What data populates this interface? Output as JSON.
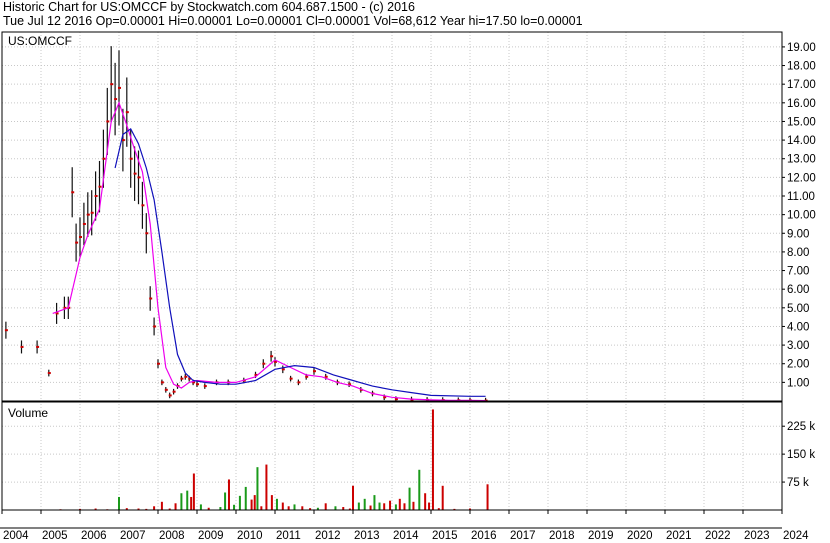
{
  "header": {
    "line1": "Historic Chart for US:OMCCF by Stockwatch.com 604.687.1500 - (c) 2016",
    "line2": "Tue Jul 12 2016   Op=0.00001   Hi=0.00001   Lo=0.00001   Cl=0.00001   Vol=68,612   Year hi=17.50   lo=0.00001"
  },
  "chart_data": {
    "type": "line",
    "price_panel": {
      "label": "US:OMCCF",
      "ylim": [
        0,
        19.8
      ],
      "yticks": [
        "1.00",
        "2.00",
        "3.00",
        "4.00",
        "5.00",
        "6.00",
        "7.00",
        "8.00",
        "9.00",
        "10.00",
        "11.00",
        "12.00",
        "13.00",
        "14.00",
        "15.00",
        "16.00",
        "17.00",
        "18.00",
        "19.00"
      ],
      "grid": true,
      "series": [
        {
          "role": "price",
          "color": "#cc0000",
          "x": [
            2004.1,
            2004.5,
            2004.9,
            2005.2,
            2005.4,
            2005.6,
            2005.7,
            2005.8,
            2005.9,
            2006.0,
            2006.1,
            2006.2,
            2006.3,
            2006.4,
            2006.5,
            2006.6,
            2006.7,
            2006.8,
            2006.9,
            2007.0,
            2007.1,
            2007.2,
            2007.3,
            2007.4,
            2007.5,
            2007.6,
            2007.7,
            2007.8,
            2007.9,
            2008.0,
            2008.1,
            2008.2,
            2008.3,
            2008.4,
            2008.5,
            2008.6,
            2008.7,
            2008.8,
            2008.9,
            2009.0,
            2009.2,
            2009.5,
            2009.8,
            2010.2,
            2010.5,
            2010.7,
            2010.9,
            2011.0,
            2011.2,
            2011.4,
            2011.6,
            2011.8,
            2012.0,
            2012.3,
            2012.6,
            2012.9,
            2013.2,
            2013.5,
            2013.8,
            2014.1,
            2014.5,
            2014.9,
            2015.3,
            2015.7,
            2016.0,
            2016.4
          ],
          "y": [
            3.8,
            2.9,
            2.9,
            1.5,
            4.7,
            5.0,
            5.0,
            11.2,
            8.5,
            8.8,
            9.5,
            10.0,
            10.1,
            11.0,
            11.5,
            13.0,
            15.0,
            17.0,
            16.2,
            16.8,
            14.0,
            15.5,
            13.0,
            12.2,
            12.0,
            10.5,
            9.0,
            5.5,
            4.0,
            2.0,
            1.0,
            0.6,
            0.3,
            0.5,
            0.8,
            1.2,
            1.3,
            1.2,
            1.0,
            0.9,
            0.8,
            1.0,
            1.0,
            1.1,
            1.4,
            2.0,
            2.4,
            2.1,
            1.7,
            1.2,
            1.0,
            1.3,
            1.6,
            1.3,
            1.0,
            0.9,
            0.6,
            0.4,
            0.2,
            0.1,
            0.08,
            0.06,
            0.05,
            0.04,
            0.03,
            0.02
          ]
        },
        {
          "role": "short_ma",
          "color": "#ee00ee",
          "x": [
            2005.3,
            2005.7,
            2006.0,
            2006.2,
            2006.5,
            2006.8,
            2007.0,
            2007.2,
            2007.4,
            2007.6,
            2007.8,
            2008.0,
            2008.2,
            2008.4,
            2008.6,
            2008.8,
            2009.0,
            2009.5,
            2010.0,
            2010.5,
            2011.0,
            2011.4,
            2011.8,
            2012.2,
            2012.6,
            2013.0,
            2013.5,
            2014.0,
            2014.5,
            2015.0,
            2015.5,
            2016.0,
            2016.4
          ],
          "y": [
            4.7,
            5.0,
            7.7,
            8.9,
            10.3,
            15.0,
            16.0,
            14.8,
            13.5,
            12.3,
            9.5,
            5.0,
            1.8,
            0.9,
            0.7,
            1.0,
            1.1,
            1.0,
            1.0,
            1.3,
            2.2,
            1.8,
            1.4,
            1.3,
            1.0,
            0.8,
            0.4,
            0.2,
            0.1,
            0.06,
            0.04,
            0.03,
            0.02
          ]
        },
        {
          "role": "long_ma",
          "color": "#1010bb",
          "x": [
            2006.9,
            2007.1,
            2007.3,
            2007.5,
            2007.7,
            2007.9,
            2008.1,
            2008.3,
            2008.5,
            2008.7,
            2008.9,
            2009.2,
            2009.6,
            2010.0,
            2010.5,
            2011.0,
            2011.5,
            2012.0,
            2012.5,
            2013.0,
            2013.5,
            2014.0,
            2014.5,
            2015.0,
            2016.0,
            2016.4
          ],
          "y": [
            12.5,
            14.3,
            14.6,
            13.8,
            12.5,
            10.8,
            8.0,
            5.0,
            2.5,
            1.5,
            1.1,
            1.0,
            0.9,
            0.9,
            1.1,
            1.7,
            1.9,
            1.8,
            1.4,
            1.1,
            0.8,
            0.6,
            0.45,
            0.3,
            0.25,
            0.25
          ]
        }
      ]
    },
    "volume_panel": {
      "label": "Volume",
      "ylim": [
        0,
        290000
      ],
      "yticks": [
        "75 k",
        "150 k",
        "225 k"
      ],
      "bars": [
        {
          "x": 2005.5,
          "y": 2000,
          "c": "#cc0000"
        },
        {
          "x": 2006.0,
          "y": 3000,
          "c": "#cc0000"
        },
        {
          "x": 2006.4,
          "y": 4000,
          "c": "#cc0000"
        },
        {
          "x": 2006.7,
          "y": 2000,
          "c": "#cc0000"
        },
        {
          "x": 2007.0,
          "y": 35000,
          "c": "#1a9a1a"
        },
        {
          "x": 2007.2,
          "y": 5000,
          "c": "#cc0000"
        },
        {
          "x": 2007.5,
          "y": 4000,
          "c": "#cc0000"
        },
        {
          "x": 2007.7,
          "y": 3000,
          "c": "#cc0000"
        },
        {
          "x": 2007.9,
          "y": 10000,
          "c": "#cc0000"
        },
        {
          "x": 2008.1,
          "y": 22000,
          "c": "#cc0000"
        },
        {
          "x": 2008.3,
          "y": 4000,
          "c": "#cc0000"
        },
        {
          "x": 2008.45,
          "y": 18000,
          "c": "#cc0000"
        },
        {
          "x": 2008.6,
          "y": 45000,
          "c": "#1a9a1a"
        },
        {
          "x": 2008.75,
          "y": 52000,
          "c": "#1a9a1a"
        },
        {
          "x": 2008.85,
          "y": 35000,
          "c": "#cc0000"
        },
        {
          "x": 2008.92,
          "y": 98000,
          "c": "#cc0000"
        },
        {
          "x": 2009.1,
          "y": 15000,
          "c": "#1a9a1a"
        },
        {
          "x": 2009.3,
          "y": 6000,
          "c": "#cc0000"
        },
        {
          "x": 2009.6,
          "y": 8000,
          "c": "#1a9a1a"
        },
        {
          "x": 2009.72,
          "y": 47000,
          "c": "#1a9a1a"
        },
        {
          "x": 2009.82,
          "y": 82000,
          "c": "#cc0000"
        },
        {
          "x": 2009.95,
          "y": 14000,
          "c": "#1a9a1a"
        },
        {
          "x": 2010.1,
          "y": 38000,
          "c": "#1a9a1a"
        },
        {
          "x": 2010.25,
          "y": 62000,
          "c": "#1a9a1a"
        },
        {
          "x": 2010.4,
          "y": 28000,
          "c": "#cc0000"
        },
        {
          "x": 2010.48,
          "y": 40000,
          "c": "#cc0000"
        },
        {
          "x": 2010.55,
          "y": 115000,
          "c": "#1a9a1a"
        },
        {
          "x": 2010.65,
          "y": 10000,
          "c": "#cc0000"
        },
        {
          "x": 2010.78,
          "y": 122000,
          "c": "#cc0000"
        },
        {
          "x": 2010.92,
          "y": 40000,
          "c": "#cc0000"
        },
        {
          "x": 2011.05,
          "y": 30000,
          "c": "#1a9a1a"
        },
        {
          "x": 2011.2,
          "y": 20000,
          "c": "#cc0000"
        },
        {
          "x": 2011.35,
          "y": 10000,
          "c": "#cc0000"
        },
        {
          "x": 2011.5,
          "y": 15000,
          "c": "#1a9a1a"
        },
        {
          "x": 2011.7,
          "y": 10000,
          "c": "#cc0000"
        },
        {
          "x": 2011.9,
          "y": 5000,
          "c": "#cc0000"
        },
        {
          "x": 2012.1,
          "y": 6000,
          "c": "#1a9a1a"
        },
        {
          "x": 2012.3,
          "y": 18000,
          "c": "#cc0000"
        },
        {
          "x": 2012.55,
          "y": 10000,
          "c": "#1a9a1a"
        },
        {
          "x": 2012.75,
          "y": 8000,
          "c": "#cc0000"
        },
        {
          "x": 2012.92,
          "y": 4000,
          "c": "#cc0000"
        },
        {
          "x": 2013.0,
          "y": 65000,
          "c": "#cc0000"
        },
        {
          "x": 2013.15,
          "y": 20000,
          "c": "#1a9a1a"
        },
        {
          "x": 2013.3,
          "y": 30000,
          "c": "#1a9a1a"
        },
        {
          "x": 2013.45,
          "y": 12000,
          "c": "#cc0000"
        },
        {
          "x": 2013.55,
          "y": 40000,
          "c": "#1a9a1a"
        },
        {
          "x": 2013.68,
          "y": 20000,
          "c": "#1a9a1a"
        },
        {
          "x": 2013.8,
          "y": 18000,
          "c": "#cc0000"
        },
        {
          "x": 2013.95,
          "y": 25000,
          "c": "#cc0000"
        },
        {
          "x": 2014.1,
          "y": 15000,
          "c": "#1a9a1a"
        },
        {
          "x": 2014.2,
          "y": 30000,
          "c": "#cc0000"
        },
        {
          "x": 2014.32,
          "y": 18000,
          "c": "#cc0000"
        },
        {
          "x": 2014.45,
          "y": 60000,
          "c": "#1a9a1a"
        },
        {
          "x": 2014.55,
          "y": 22000,
          "c": "#cc0000"
        },
        {
          "x": 2014.7,
          "y": 108000,
          "c": "#1a9a1a"
        },
        {
          "x": 2014.85,
          "y": 45000,
          "c": "#cc0000"
        },
        {
          "x": 2014.95,
          "y": 20000,
          "c": "#cc0000"
        },
        {
          "x": 2015.05,
          "y": 270000,
          "c": "#cc0000"
        },
        {
          "x": 2015.2,
          "y": 5000,
          "c": "#cc0000"
        },
        {
          "x": 2015.3,
          "y": 65000,
          "c": "#cc0000"
        },
        {
          "x": 2015.6,
          "y": 3000,
          "c": "#cc0000"
        },
        {
          "x": 2016.0,
          "y": 4000,
          "c": "#cc0000"
        },
        {
          "x": 2016.45,
          "y": 69000,
          "c": "#cc0000"
        }
      ]
    },
    "x_axis": {
      "xlim": [
        2004,
        2024
      ],
      "ticks": [
        "2004",
        "2005",
        "2006",
        "2007",
        "2008",
        "2009",
        "2010",
        "2011",
        "2012",
        "2013",
        "2014",
        "2015",
        "2016",
        "2017",
        "2018",
        "2019",
        "2020",
        "2021",
        "2022",
        "2023",
        "2024"
      ]
    }
  }
}
